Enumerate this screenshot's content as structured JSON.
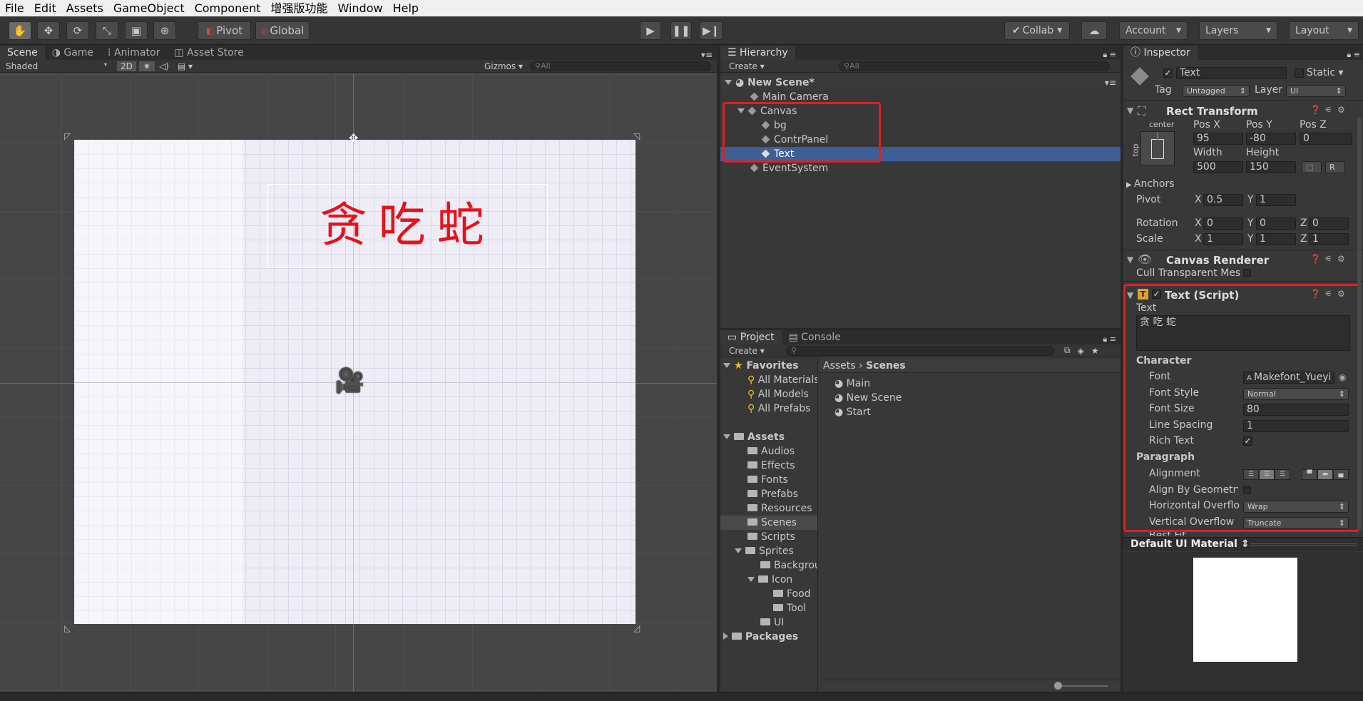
{
  "menu": [
    "File",
    "Edit",
    "Assets",
    "GameObject",
    "Component",
    "增强版功能",
    "Window",
    "Help"
  ],
  "toolbar": {
    "pivot": "Pivot",
    "global": "Global",
    "collab": "Collab",
    "account": "Account",
    "layers": "Layers",
    "layout": "Layout"
  },
  "scene": {
    "tabs": [
      "Scene",
      "Game",
      "Animator",
      "Asset Store"
    ],
    "shading": "Shaded",
    "mode2d": "2D",
    "gizmos": "Gizmos",
    "search": "All",
    "title_text": "贪吃蛇"
  },
  "hierarchy": {
    "tab": "Hierarchy",
    "create": "Create",
    "search": "All",
    "scene": "New Scene*",
    "items": [
      "Main Camera",
      "Canvas",
      "bg",
      "ContrPanel",
      "Text",
      "EventSystem"
    ]
  },
  "project": {
    "tabs": [
      "Project",
      "Console"
    ],
    "create": "Create",
    "favorites": "Favorites",
    "fav_items": [
      "All Materials",
      "All Models",
      "All Prefabs"
    ],
    "assets": "Assets",
    "folders": [
      "Audios",
      "Effects",
      "Fonts",
      "Prefabs",
      "Resources",
      "Scenes",
      "Scripts",
      "Sprites",
      "Backgrou",
      "Icon",
      "Food",
      "Tool",
      "UI"
    ],
    "packages": "Packages",
    "breadcrumb": [
      "Assets",
      "Scenes"
    ],
    "files": [
      "Main",
      "New Scene",
      "Start"
    ]
  },
  "inspector": {
    "tab": "Inspector",
    "name": "Text",
    "static": "Static",
    "tag_label": "Tag",
    "tag": "Untagged",
    "layer_label": "Layer",
    "layer": "UI",
    "rect": {
      "title": "Rect Transform",
      "anchor_h": "center",
      "anchor_v": "top",
      "posx_l": "Pos X",
      "posy_l": "Pos Y",
      "posz_l": "Pos Z",
      "posx": "95",
      "posy": "-80",
      "posz": "0",
      "width_l": "Width",
      "height_l": "Height",
      "width": "500",
      "height": "150",
      "anchors": "Anchors",
      "pivot": "Pivot",
      "px": "0.5",
      "py": "1",
      "rotation": "Rotation",
      "rx": "0",
      "ry": "0",
      "rz": "0",
      "scale": "Scale",
      "sx": "1",
      "sy": "1",
      "sz": "1",
      "x": "X",
      "y": "Y",
      "z": "Z",
      "r": "R"
    },
    "canvas_renderer": {
      "title": "Canvas Renderer",
      "cull": "Cull Transparent Mes"
    },
    "text_script": {
      "title": "Text (Script)",
      "text_l": "Text",
      "text": "贪 吃 蛇",
      "character": "Character",
      "font_l": "Font",
      "font": "Makefont_Yueyi",
      "style_l": "Font Style",
      "style": "Normal",
      "size_l": "Font Size",
      "size": "80",
      "spacing_l": "Line Spacing",
      "spacing": "1",
      "rich_l": "Rich Text",
      "paragraph": "Paragraph",
      "align_l": "Alignment",
      "geom_l": "Align By Geometry",
      "hover_l": "Horizontal Overflo",
      "hover": "Wrap",
      "vover_l": "Vertical Overflow",
      "vover": "Truncate",
      "best_l": "Best Fit"
    },
    "material": "Default UI Material"
  },
  "colors": {
    "accent": "#3e5f96",
    "red": "#e01f1f",
    "title": "#e8101a"
  }
}
